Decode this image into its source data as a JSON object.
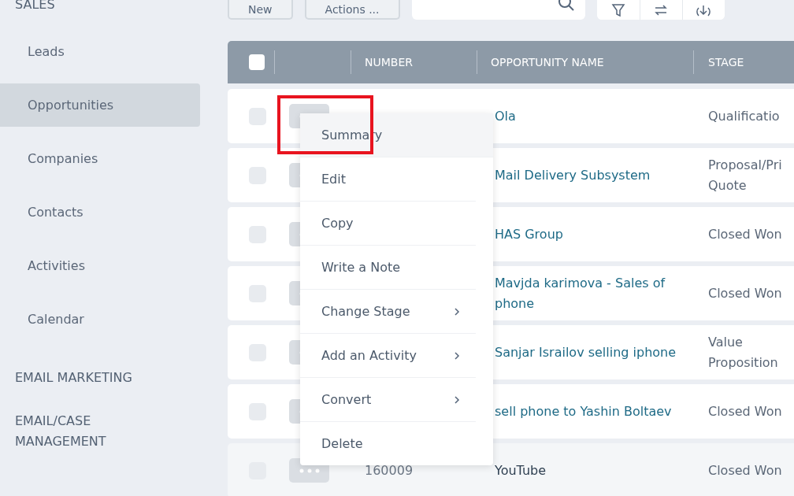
{
  "sidebar": {
    "sections": [
      {
        "title": "SALES",
        "items": [
          {
            "label": "Leads",
            "selected": false
          },
          {
            "label": "Opportunities",
            "selected": true
          },
          {
            "label": "Companies",
            "selected": false
          },
          {
            "label": "Contacts",
            "selected": false
          },
          {
            "label": "Activities",
            "selected": false
          },
          {
            "label": "Calendar",
            "selected": false
          }
        ]
      },
      {
        "title": "EMAIL MARKETING"
      },
      {
        "title": "EMAIL/CASE MANAGEMENT"
      }
    ]
  },
  "toolbar": {
    "buttons": [
      "New",
      "Actions ..."
    ]
  },
  "table": {
    "header_checkbox": {
      "checked": false
    },
    "columns": [
      "NUMBER",
      "OPPORTUNITY NAME",
      "STAGE"
    ],
    "rows": [
      {
        "number": "",
        "name": "Ola",
        "stage": "Qualificatio",
        "checked": false,
        "hovered": false
      },
      {
        "number": "",
        "name": "Mail Delivery Subsystem",
        "stage": "Proposal/Pri Quote",
        "checked": false,
        "hovered": false
      },
      {
        "number": "",
        "name": "HAS Group",
        "stage": "Closed Won",
        "checked": false,
        "hovered": false
      },
      {
        "number": "",
        "name": "Mavjda karimova - Sales of phone",
        "stage": "Closed Won",
        "checked": false,
        "hovered": false
      },
      {
        "number": "",
        "name": "Sanjar Israilov selling iphone",
        "stage": "Value Proposition",
        "checked": false,
        "hovered": false
      },
      {
        "number": "",
        "name": "sell phone to Yashin Boltaev",
        "stage": "Closed Won",
        "checked": false,
        "hovered": false
      },
      {
        "number": "160009",
        "name": "YouTube",
        "stage": "Closed Won",
        "checked": false,
        "hovered": true
      }
    ]
  },
  "context_menu": {
    "items": [
      {
        "label": "Summary",
        "submenu": false,
        "selected": true,
        "annotated": true
      },
      {
        "label": "Edit",
        "submenu": false,
        "selected": false,
        "annotated": false
      },
      {
        "label": "Copy",
        "submenu": false,
        "selected": false,
        "annotated": false
      },
      {
        "label": "Write a Note",
        "submenu": false,
        "selected": false,
        "annotated": false
      },
      {
        "label": "Change Stage",
        "submenu": true,
        "selected": false,
        "annotated": false
      },
      {
        "label": "Add an Activity",
        "submenu": true,
        "selected": false,
        "annotated": false
      },
      {
        "label": "Convert",
        "submenu": true,
        "selected": false,
        "annotated": false
      },
      {
        "label": "Delete",
        "submenu": false,
        "selected": false,
        "annotated": false
      }
    ]
  }
}
